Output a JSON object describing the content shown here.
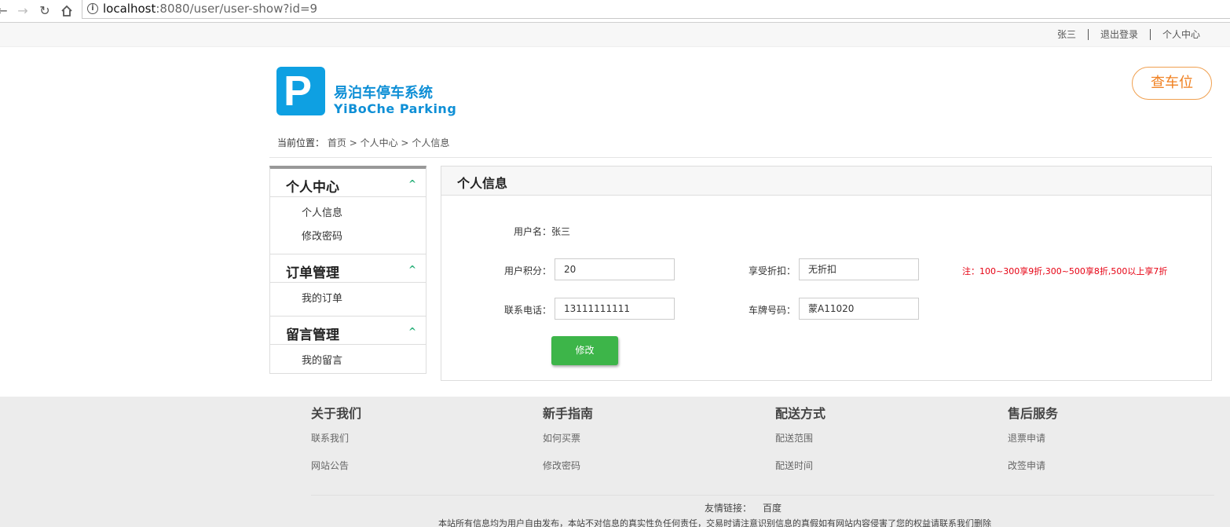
{
  "browser": {
    "url_host": "localhost",
    "url_path": ":8080/user/user-show?id=9"
  },
  "topbar": {
    "username": "张三",
    "logout": "退出登录",
    "user_center": "个人中心"
  },
  "header": {
    "logo_letter": "P",
    "brand_cn": "易泊车停车系统",
    "brand_en": "YiBoChe  Parking",
    "check_button": "查车位"
  },
  "breadcrumb": {
    "label": "当前位置：",
    "items": [
      "首页",
      ">",
      "个人中心",
      ">",
      "个人信息"
    ]
  },
  "sidebar": {
    "sections": [
      {
        "title": "个人中心",
        "items": [
          "个人信息",
          "修改密码"
        ]
      },
      {
        "title": "订单管理",
        "items": [
          "我的订单"
        ]
      },
      {
        "title": "留言管理",
        "items": [
          "我的留言"
        ]
      }
    ],
    "chevron": "^"
  },
  "main": {
    "title": "个人信息",
    "username_label": "用户名：",
    "username_value": "张三",
    "points_label": "用户积分：",
    "points_value": "20",
    "discount_label": "享受折扣：",
    "discount_value": "无折扣",
    "note": "注：100~300享9折,300~500享8折,500以上享7折",
    "phone_label": "联系电话：",
    "phone_value": "13111111111",
    "plate_label": "车牌号码：",
    "plate_value": "蒙A11020",
    "submit": "修改"
  },
  "footer": {
    "columns": [
      {
        "title": "关于我们",
        "links": [
          "联系我们",
          "网站公告"
        ]
      },
      {
        "title": "新手指南",
        "links": [
          "如何买票",
          "修改密码"
        ]
      },
      {
        "title": "配送方式",
        "links": [
          "配送范围",
          "配送时间"
        ]
      },
      {
        "title": "售后服务",
        "links": [
          "退票申请",
          "改签申请"
        ]
      }
    ],
    "friend_label": "友情链接：",
    "friend_link": "百度",
    "disclaimer": "本站所有信息均为用户自由发布，本站不对信息的真实性负任何责任，交易时请注意识别信息的真假如有网站内容侵害了您的权益请联系我们删除"
  },
  "colors": {
    "brand_blue": "#0ea0e2",
    "accent_orange": "#f08020",
    "green_button": "#3db549",
    "note_red": "#e60012"
  }
}
